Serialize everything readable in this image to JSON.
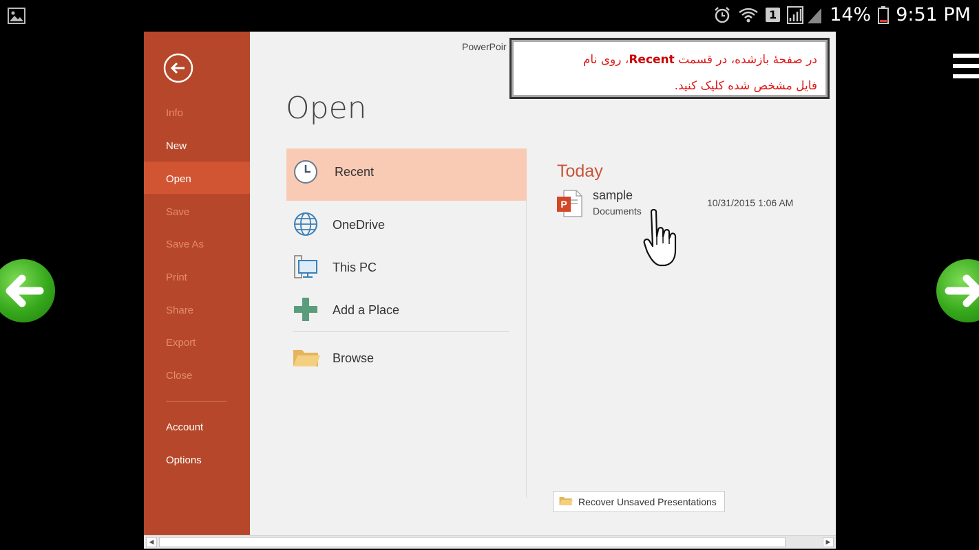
{
  "status_bar": {
    "battery": "14%",
    "time": "9:51 PM",
    "sim_badge": "1"
  },
  "app": {
    "title": "PowerPoir"
  },
  "sidebar": {
    "items": [
      {
        "label": "Info"
      },
      {
        "label": "New"
      },
      {
        "label": "Open"
      },
      {
        "label": "Save"
      },
      {
        "label": "Save As"
      },
      {
        "label": "Print"
      },
      {
        "label": "Share"
      },
      {
        "label": "Export"
      },
      {
        "label": "Close"
      },
      {
        "label": "Account"
      },
      {
        "label": "Options"
      }
    ],
    "active": "Open"
  },
  "main": {
    "page_title": "Open",
    "locations": [
      {
        "label": "Recent",
        "icon": "clock-icon"
      },
      {
        "label": "OneDrive",
        "icon": "globe-icon"
      },
      {
        "label": "This PC",
        "icon": "computer-icon"
      },
      {
        "label": "Add a Place",
        "icon": "plus-icon"
      },
      {
        "label": "Browse",
        "icon": "folder-icon"
      }
    ],
    "recent": {
      "group": "Today",
      "files": [
        {
          "name": "sample",
          "location": "Documents",
          "date": "10/31/2015 1:06 AM"
        }
      ]
    },
    "recover_button": "Recover Unsaved Presentations"
  },
  "note": {
    "line1_part1": "در صفحهٔ بازشده، در قسمت ",
    "line1_bold": "Recent",
    "line1_part2": "، روی نام",
    "line2": "فایل مشخص شده کلیک کنید."
  },
  "colors": {
    "accent": "#b7472a",
    "active_nav": "#d25533",
    "recent_highlight": "#f9cbb4",
    "note_text": "#e01818"
  }
}
